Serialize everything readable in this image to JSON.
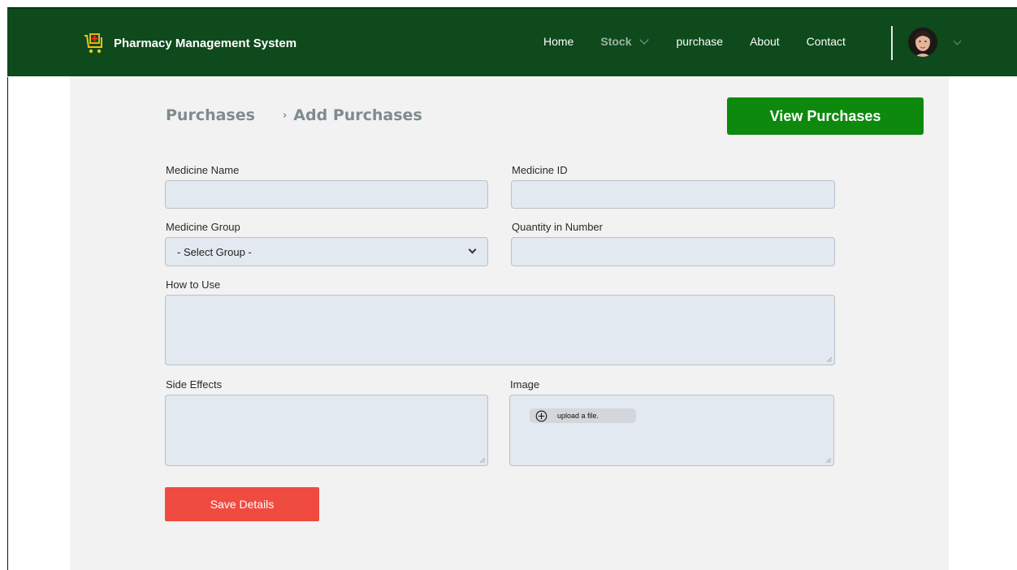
{
  "header": {
    "app_name": "Pharmacy Management System",
    "nav": [
      "Home",
      "Stock",
      "purchase",
      "About",
      "Contact"
    ]
  },
  "breadcrumb": {
    "parent": "Purchases",
    "separator": "›",
    "current": "Add Purchases"
  },
  "actions": {
    "view_purchases": "View Purchases",
    "save": "Save Details"
  },
  "form": {
    "medicine_name": {
      "label": "Medicine Name",
      "value": ""
    },
    "medicine_id": {
      "label": "Medicine ID",
      "value": ""
    },
    "medicine_group": {
      "label": "Medicine Group",
      "selected": "- Select Group -"
    },
    "quantity": {
      "label": "Quantity in Number",
      "value": ""
    },
    "how_to_use": {
      "label": "How to Use",
      "value": ""
    },
    "side_effects": {
      "label": "Side Effects",
      "value": ""
    },
    "image": {
      "label": "Image",
      "upload_label": "upload a file."
    }
  },
  "colors": {
    "header_bg": "#0e4a1c",
    "primary_button": "#0d8a0d",
    "save_button": "#f04b41",
    "field_bg": "#e3e9f0",
    "panel_bg": "#f2f2f2"
  },
  "icons": [
    "pharmacy-cart-icon",
    "chevron-down-icon",
    "avatar",
    "plus-circle-icon"
  ]
}
